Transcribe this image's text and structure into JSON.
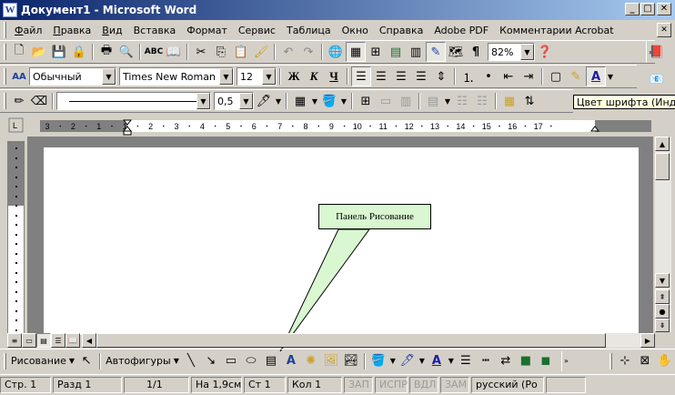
{
  "window": {
    "title": "Документ1 - Microsoft Word",
    "app_icon": "W"
  },
  "menu": [
    {
      "accel": "Ф",
      "rest": "айл"
    },
    {
      "accel": "П",
      "rest": "равка"
    },
    {
      "accel": "В",
      "rest": "ид"
    },
    {
      "accel": "",
      "rest": "Вставка"
    },
    {
      "accel": "",
      "rest": "Формат"
    },
    {
      "accel": "",
      "rest": "Сервис"
    },
    {
      "accel": "",
      "rest": "Таблица"
    },
    {
      "accel": "",
      "rest": "Окно"
    },
    {
      "accel": "",
      "rest": "Справка"
    },
    {
      "accel": "",
      "rest": "Adobe PDF"
    },
    {
      "accel": "",
      "rest": "Комментарии Acrobat"
    }
  ],
  "standard_toolbar": {
    "zoom": "82%",
    "help_icon": "help-icon"
  },
  "formatting_toolbar": {
    "style": "Обычный",
    "font": "Times New Roman",
    "size": "12",
    "bold": "Ж",
    "italic": "К",
    "underline": "Ч",
    "style_icon": "AA"
  },
  "tables_toolbar": {
    "line_weight": "0,5"
  },
  "tooltip": "Цвет шрифта (Индиг",
  "ruler": {
    "labels": [
      "3",
      "2",
      "1",
      "1",
      "2",
      "3",
      "4",
      "5",
      "6",
      "7",
      "8",
      "9",
      "10",
      "11",
      "12",
      "13",
      "14",
      "15",
      "16",
      "17"
    ]
  },
  "callout": {
    "text": "Панель Рисование"
  },
  "drawing_toolbar": {
    "draw_menu": "Рисование",
    "autoshapes": "Автофигуры"
  },
  "status": {
    "page": "Стр.  1",
    "section": "Разд  1",
    "pages": "1/1",
    "at": "На  1,9см",
    "line": "Ст  1",
    "col": "Кол  1",
    "rec": "ЗАП",
    "trk": "ИСПР",
    "ext": "ВДЛ",
    "ovr": "ЗАМ",
    "lang": "русский (Ро"
  },
  "colors": {
    "title_start": "#0a246a",
    "title_end": "#a6caf0",
    "callout_fill": "#d9f7d1",
    "font_color": "#1a1aa6"
  }
}
